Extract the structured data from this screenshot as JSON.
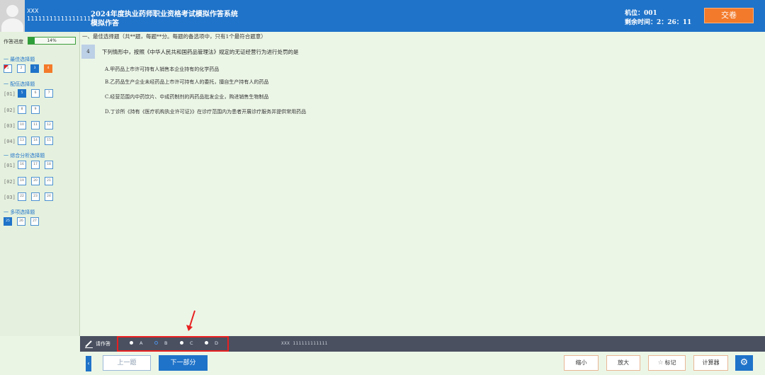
{
  "header": {
    "user_name": "XXX",
    "user_id": "111111111111111111",
    "system_title": "2024年度执业药师职业资格考试模拟作答系统",
    "system_subtitle": "模拟作答",
    "seat": "机位：001",
    "remaining_time": "剩余时间：2：26：11",
    "submit_label": "交卷"
  },
  "sidebar": {
    "progress_label": "作答进度",
    "progress_percent": 14,
    "progress_text": "14%",
    "sections": [
      {
        "title": "一 最佳选择题"
      },
      {
        "title": "一 配伍选择题"
      },
      {
        "title": "一 综合分析选择题"
      },
      {
        "title": "一 多项选择题"
      }
    ],
    "groups": [
      "[01]",
      "[02]",
      "[03]",
      "[04]",
      "[01]",
      "[02]",
      "[03]"
    ],
    "questions": [
      "1",
      "2",
      "3",
      "4",
      "5",
      "6",
      "7",
      "8",
      "9",
      "10",
      "11",
      "12",
      "13",
      "14",
      "15",
      "16",
      "17",
      "18",
      "19",
      "20",
      "21",
      "22",
      "23",
      "24",
      "25",
      "26",
      "27"
    ]
  },
  "main": {
    "section_header": "一、最佳选择题（共**题，每题**分。每题的备选项中，只有1个最符合题意）",
    "question_number": "4",
    "stem": "下列情形中，按照《中华人民共和国药品管理法》规定的无证经营行为进行处罚的是",
    "options": [
      "A.甲药品上市许可持有人销售本企业持有的化学药品",
      "B.乙药品生产企业未经药品上市许可持有人的委托，擅自生产持有人的药品",
      "C.经营范围内中药饮片、中成药制剂的丙药品批发企业，购进销售生物制品",
      "D.丁诊所《持有《医疗机构执业许可证》》在诊疗范围内为患者开展诊疗服务并提供常用药品"
    ]
  },
  "answer_bar": {
    "label": "请作答",
    "options": [
      "A",
      "B",
      "C",
      "D"
    ],
    "selected": "B",
    "info": "XXX 111111111111"
  },
  "toolbar": {
    "prev_label": "上一题",
    "next_label": "下一部分",
    "shrink_label": "缩小",
    "enlarge_label": "放大",
    "mark_label": "标记",
    "calculator_label": "计算器"
  },
  "colors": {
    "header_blue": "#1f73c9",
    "submit_orange": "#f37a2a",
    "background_green": "#ecf6e7",
    "answer_bar": "#4a5060",
    "highlight_red": "#e82020"
  }
}
